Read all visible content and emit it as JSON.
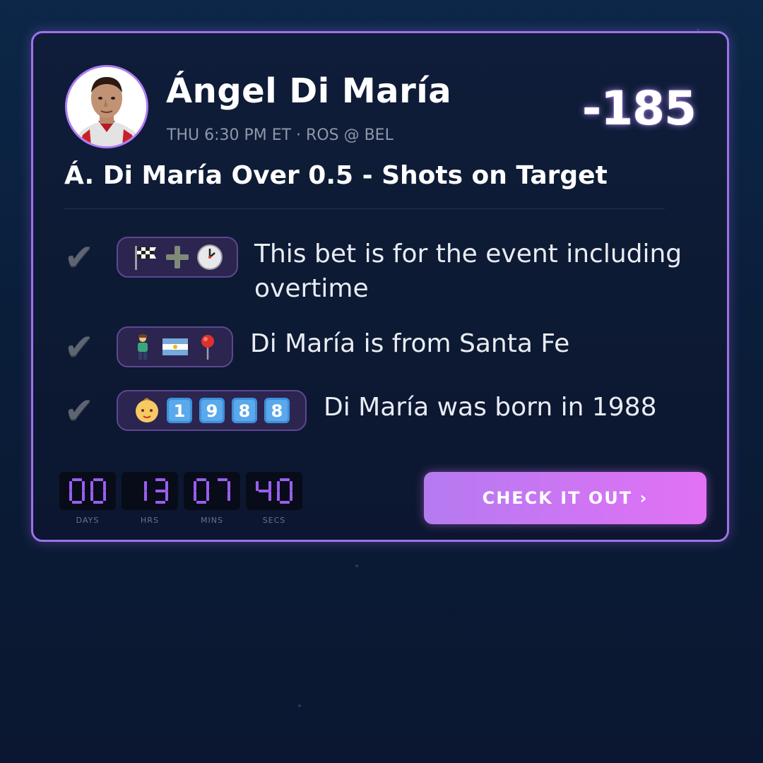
{
  "player": {
    "name": "Ángel Di María",
    "game_info": "THU 6:30 PM ET · ROS @ BEL",
    "odds": "-185"
  },
  "bet": {
    "title": "Á. Di María Over 0.5 - Shots on Target"
  },
  "facts": [
    {
      "check": "✔",
      "emojis": [
        "chequered-flag",
        "plus",
        "clock"
      ],
      "text": "This bet is for the event including overtime"
    },
    {
      "check": "✔",
      "emojis": [
        "person",
        "argentina-flag",
        "round-pushpin"
      ],
      "text": "Di María is from Santa Fe"
    },
    {
      "check": "✔",
      "emojis": [
        "baby",
        "keycap-1",
        "keycap-9",
        "keycap-8",
        "keycap-8"
      ],
      "text": "Di María was born in 1988"
    }
  ],
  "countdown": {
    "days": "00",
    "hrs": "13",
    "mins": "07",
    "secs": "40",
    "labels": {
      "days": "DAYS",
      "hrs": "HRS",
      "mins": "MINS",
      "secs": "SECS"
    }
  },
  "cta": {
    "label": "CHECK IT OUT ›"
  },
  "colors": {
    "accent": "#a070ec",
    "cta_start": "#b57af0",
    "cta_end": "#e271f5",
    "digit": "#9a5ef0"
  }
}
